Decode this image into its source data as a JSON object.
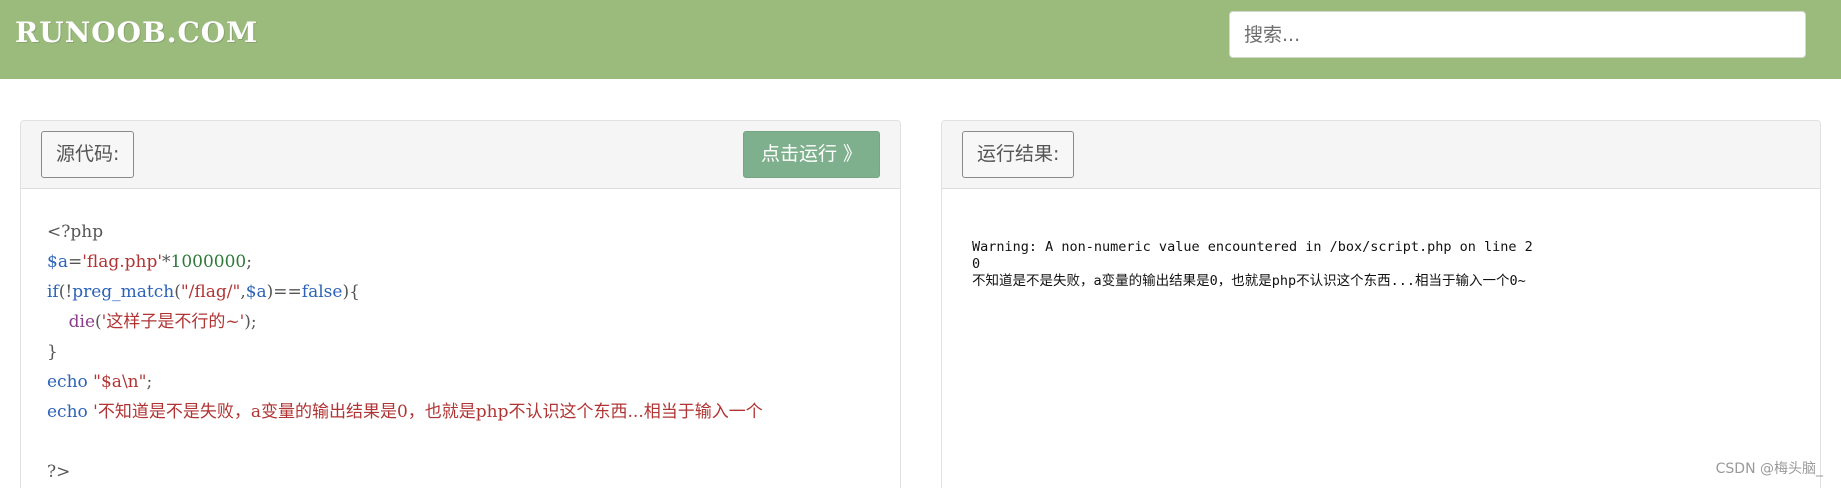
{
  "header": {
    "logo": "RUNOOB.COM",
    "search_placeholder": "搜索..."
  },
  "source_panel": {
    "label": "源代码:",
    "run_button": "点击运行 》",
    "code_lines": [
      {
        "segments": [
          {
            "t": "<?php",
            "c": "plain"
          }
        ]
      },
      {
        "segments": [
          {
            "t": "$a",
            "c": "var"
          },
          {
            "t": "=",
            "c": "plain"
          },
          {
            "t": "'flag.php'",
            "c": "str"
          },
          {
            "t": "*",
            "c": "plain"
          },
          {
            "t": "1000000",
            "c": "num"
          },
          {
            "t": ";",
            "c": "plain"
          }
        ]
      },
      {
        "segments": [
          {
            "t": "if",
            "c": "kw"
          },
          {
            "t": "(!",
            "c": "plain"
          },
          {
            "t": "preg_match",
            "c": "fn"
          },
          {
            "t": "(",
            "c": "plain"
          },
          {
            "t": "\"/flag/\"",
            "c": "str"
          },
          {
            "t": ",",
            "c": "plain"
          },
          {
            "t": "$a",
            "c": "var"
          },
          {
            "t": ")==",
            "c": "plain"
          },
          {
            "t": "false",
            "c": "kw"
          },
          {
            "t": "){",
            "c": "plain"
          }
        ]
      },
      {
        "segments": [
          {
            "t": "    ",
            "c": "plain"
          },
          {
            "t": "die",
            "c": "die"
          },
          {
            "t": "(",
            "c": "plain"
          },
          {
            "t": "'这样子是不行的~'",
            "c": "str"
          },
          {
            "t": ");",
            "c": "plain"
          }
        ]
      },
      {
        "segments": [
          {
            "t": "}",
            "c": "plain"
          }
        ]
      },
      {
        "segments": [
          {
            "t": "echo",
            "c": "kw"
          },
          {
            "t": " ",
            "c": "plain"
          },
          {
            "t": "\"$a\\n\"",
            "c": "str"
          },
          {
            "t": ";",
            "c": "plain"
          }
        ]
      },
      {
        "segments": [
          {
            "t": "echo",
            "c": "kw"
          },
          {
            "t": " ",
            "c": "plain"
          },
          {
            "t": "'不知道是不是失败，a变量的输出结果是0，也就是php不认识这个东西...相当于输入一个",
            "c": "str"
          }
        ]
      },
      {
        "segments": []
      },
      {
        "segments": [
          {
            "t": "?>",
            "c": "plain"
          }
        ]
      }
    ]
  },
  "result_panel": {
    "label": "运行结果:",
    "output": "Warning: A non-numeric value encountered in /box/script.php on line 2\n0\n不知道是不是失败，a变量的输出结果是0，也就是php不认识这个东西...相当于输入一个0~"
  },
  "watermark": "CSDN @梅头脑_"
}
